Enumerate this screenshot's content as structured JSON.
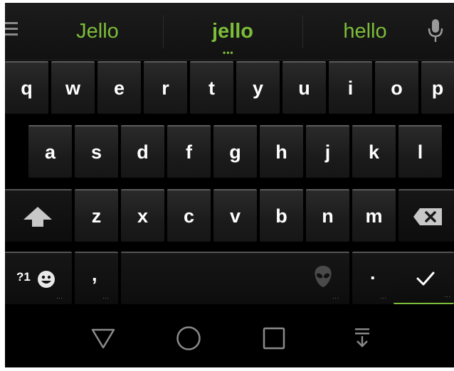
{
  "suggestions": {
    "left": "Jello",
    "center": "jello",
    "right": "hello",
    "more_indicator": "•••"
  },
  "rows": {
    "row1": [
      "q",
      "w",
      "e",
      "r",
      "t",
      "y",
      "u",
      "i",
      "o",
      "p"
    ],
    "row2": [
      "a",
      "s",
      "d",
      "f",
      "g",
      "h",
      "j",
      "k",
      "l"
    ],
    "row3": [
      "z",
      "x",
      "c",
      "v",
      "b",
      "n",
      "m"
    ]
  },
  "bottom_row": {
    "symbols_label": "?1",
    "comma": ",",
    "period": "."
  },
  "accent_color": "#7cbd3a",
  "icons": [
    "menu-icon",
    "mic-icon",
    "shift-icon",
    "backspace-icon",
    "emoji-icon",
    "alien-icon",
    "checkmark-icon",
    "back-icon",
    "home-icon",
    "recents-icon",
    "hide-keyboard-icon"
  ]
}
